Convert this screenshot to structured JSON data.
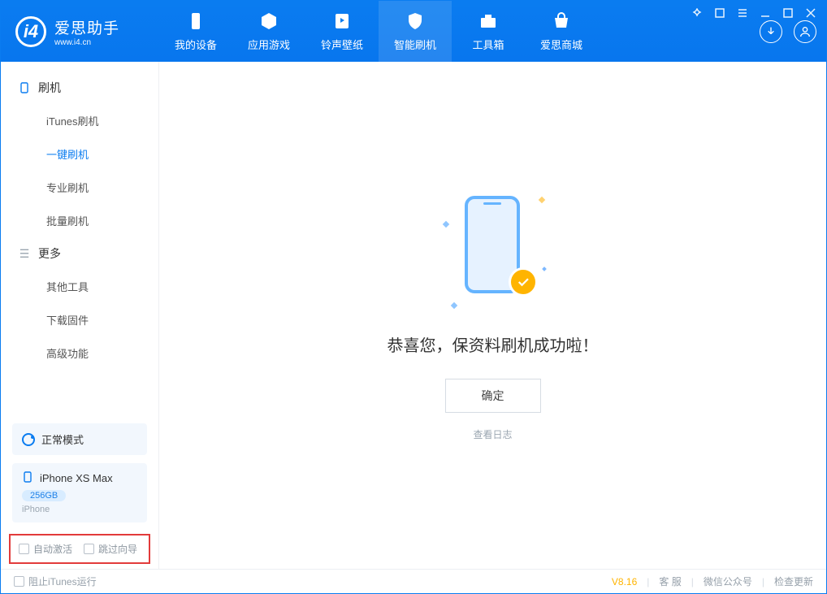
{
  "app": {
    "name_cn": "爱思助手",
    "url": "www.i4.cn"
  },
  "nav": {
    "items": [
      {
        "label": "我的设备"
      },
      {
        "label": "应用游戏"
      },
      {
        "label": "铃声壁纸"
      },
      {
        "label": "智能刷机"
      },
      {
        "label": "工具箱"
      },
      {
        "label": "爱思商城"
      }
    ]
  },
  "sidebar": {
    "group1": "刷机",
    "items1": [
      "iTunes刷机",
      "一键刷机",
      "专业刷机",
      "批量刷机"
    ],
    "group2": "更多",
    "items2": [
      "其他工具",
      "下载固件",
      "高级功能"
    ]
  },
  "device_mode_card": {
    "label": "正常模式"
  },
  "device_card": {
    "name": "iPhone XS Max",
    "capacity": "256GB",
    "type": "iPhone"
  },
  "highlight": {
    "opt1": "自动激活",
    "opt2": "跳过向导"
  },
  "main": {
    "success": "恭喜您，保资料刷机成功啦！",
    "ok": "确定",
    "view_log": "查看日志"
  },
  "footer": {
    "block_itunes": "阻止iTunes运行",
    "version": "V8.16",
    "support": "客 服",
    "wechat": "微信公众号",
    "update": "检查更新"
  }
}
